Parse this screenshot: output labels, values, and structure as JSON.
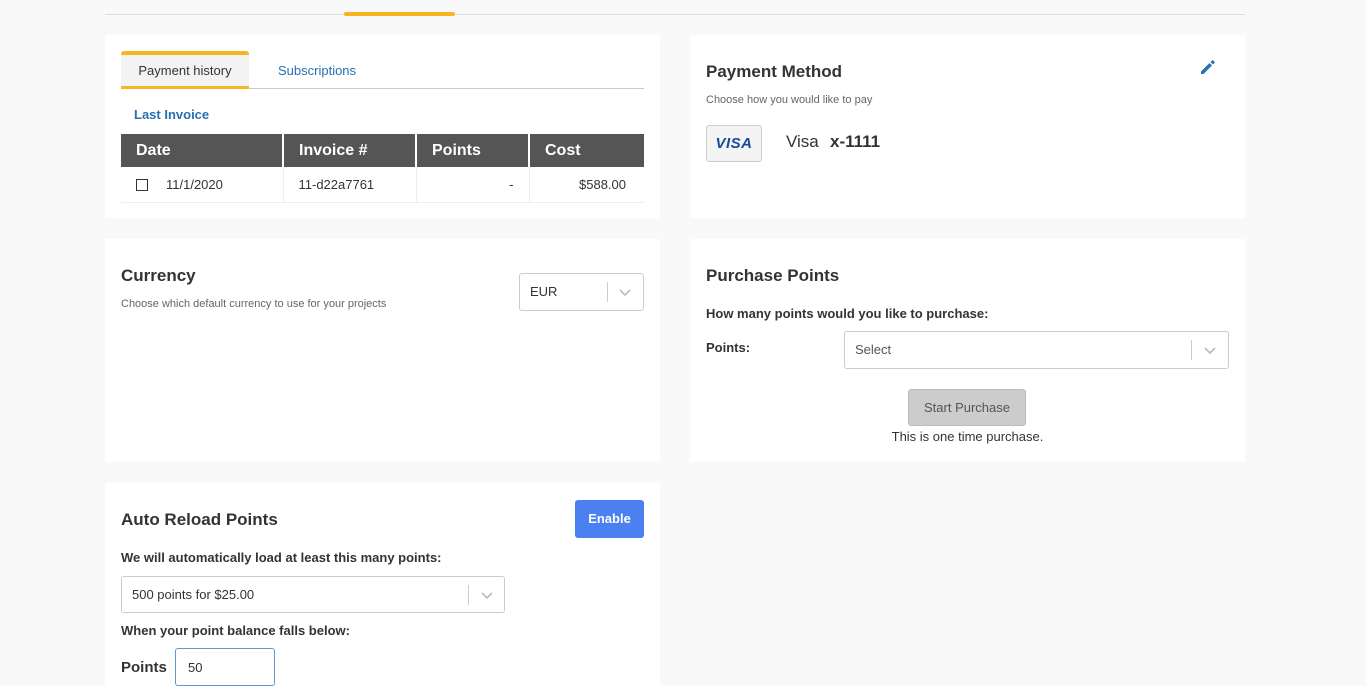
{
  "tabs": {
    "payment_history": "Payment history",
    "subscriptions": "Subscriptions"
  },
  "history": {
    "last_invoice_link": "Last Invoice",
    "columns": [
      "Date",
      "Invoice #",
      "Points",
      "Cost"
    ],
    "rows": [
      {
        "date": "11/1/2020",
        "invoice": "11-d22a7761",
        "points": "-",
        "cost": "$588.00"
      }
    ]
  },
  "payment": {
    "title": "Payment Method",
    "subtitle": "Choose how you would like to pay",
    "card_logo": "VISA",
    "card_brand": "Visa",
    "card_last4": "x-1111",
    "edit_icon": "pencil-icon"
  },
  "currency": {
    "title": "Currency",
    "subtitle": "Choose which default currency to use for your projects",
    "selected": "EUR"
  },
  "purchase": {
    "title": "Purchase Points",
    "question": "How many points would you like to purchase:",
    "points_label": "Points:",
    "select_placeholder": "Select",
    "button_label": "Start Purchase",
    "note": "This is one time purchase."
  },
  "reload": {
    "title": "Auto Reload Points",
    "enable_label": "Enable",
    "load_label": "We will automatically load at least this many points:",
    "load_selected": "500 points for $25.00",
    "threshold_label": "When your point balance falls below:",
    "points_label": "Points",
    "points_value": "50"
  },
  "colors": {
    "accent": "#f5b620",
    "link": "#2870b0",
    "primary_button": "#4a80f0",
    "table_header": "#555555"
  }
}
